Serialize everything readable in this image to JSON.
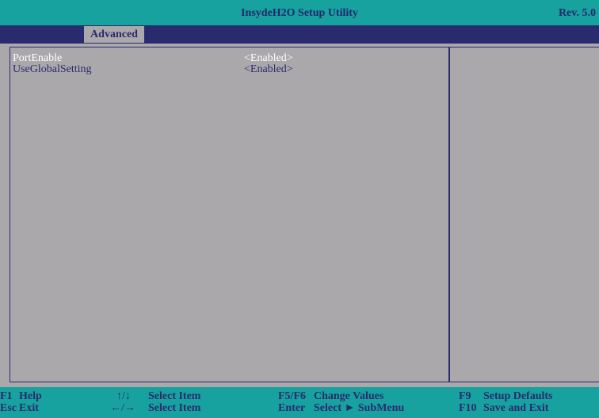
{
  "header": {
    "title": "InsydeH2O Setup Utility",
    "revision": "Rev. 5.0"
  },
  "menu": {
    "tabs": [
      {
        "label": "Advanced",
        "selected": true
      }
    ]
  },
  "settings": [
    {
      "label": "PortEnable",
      "value": "<Enabled>",
      "selected": true
    },
    {
      "label": "UseGlobalSetting",
      "value": "<Enabled>",
      "selected": false
    }
  ],
  "footer": {
    "f1_key": "F1",
    "f1_desc": "Help",
    "esc_key": "Esc",
    "esc_desc": "Exit",
    "updown_key": "↑/↓",
    "updown_desc": "Select Item",
    "leftright_key": "←/→",
    "leftright_desc": "Select Item",
    "f5f6_key": "F5/F6",
    "f5f6_desc": "Change Values",
    "enter_key": "Enter",
    "enter_desc": "Select ► SubMenu",
    "f9_key": "F9",
    "f9_desc": "Setup Defaults",
    "f10_key": "F10",
    "f10_desc": "Save and Exit"
  },
  "colors": {
    "title_bar": "#17a2a0",
    "menu_bar": "#2a2a6e",
    "background": "#aba8ab",
    "highlight_text": "#ffffff",
    "normal_text": "#2a2a6e"
  }
}
